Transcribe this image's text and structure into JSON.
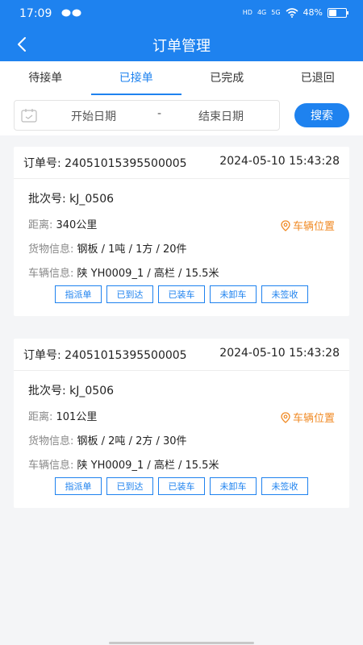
{
  "status_bar": {
    "time": "17:09",
    "signal_labels": [
      "HD",
      "4G",
      "5G"
    ],
    "battery": "48%"
  },
  "header": {
    "title": "订单管理",
    "back_icon": "chevron-left-icon"
  },
  "tabs": [
    {
      "label": "待接单",
      "active": false
    },
    {
      "label": "已接单",
      "active": true
    },
    {
      "label": "已完成",
      "active": false
    },
    {
      "label": "已退回",
      "active": false
    }
  ],
  "filter": {
    "start_date": "开始日期",
    "separator": "-",
    "end_date": "结束日期",
    "search_label": "搜索"
  },
  "orders": [
    {
      "order_no": "订单号: 24051015395500005",
      "time": "2024-05-10 15:43:28",
      "batch": "批次号: kJ_0506",
      "distance_label": "距离: ",
      "distance": "340公里",
      "location_label": "车辆位置",
      "goods_label": "货物信息: ",
      "goods": "钢板 / 1吨 / 1方 / 20件",
      "vehicle_label": "车辆信息: ",
      "vehicle": "陕 YH0009_1 / 高栏 / 15.5米",
      "statuses": [
        "指派单",
        "已到达",
        "已装车",
        "未卸车",
        "未签收"
      ]
    },
    {
      "order_no": "订单号: 24051015395500005",
      "time": "2024-05-10 15:43:28",
      "batch": "批次号: kJ_0506",
      "distance_label": "距离: ",
      "distance": "101公里",
      "location_label": "车辆位置",
      "goods_label": "货物信息: ",
      "goods": "钢板 / 2吨 / 2方 / 30件",
      "vehicle_label": "车辆信息: ",
      "vehicle": "陕 YH0009_1 / 高栏 / 15.5米",
      "statuses": [
        "指派单",
        "已到达",
        "已装车",
        "未卸车",
        "未签收"
      ]
    }
  ],
  "colors": {
    "primary": "#1e82ef",
    "accent_orange": "#f08a24",
    "background": "#f4f5f7"
  }
}
